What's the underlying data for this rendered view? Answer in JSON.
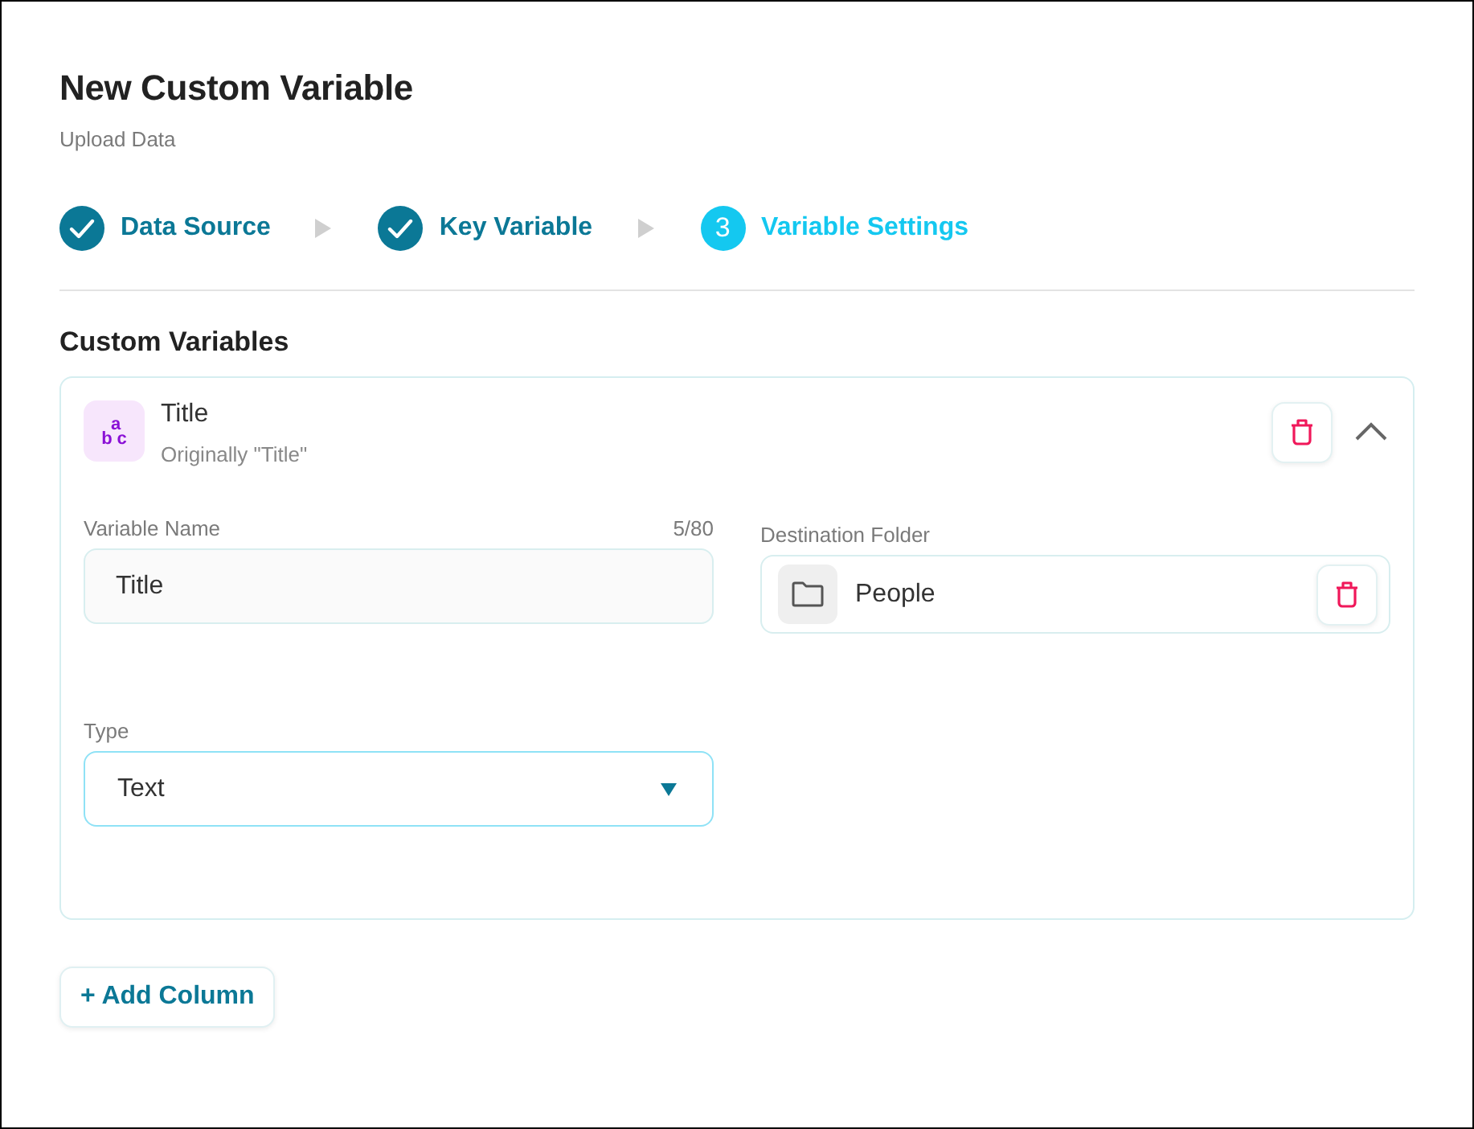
{
  "header": {
    "title": "New Custom Variable",
    "subtitle": "Upload Data"
  },
  "steps": [
    {
      "label": "Data Source",
      "completed": true,
      "selected": false
    },
    {
      "label": "Key Variable",
      "completed": true,
      "selected": false
    },
    {
      "label": "Variable Settings",
      "number": "3",
      "completed": false,
      "selected": true
    }
  ],
  "section": {
    "title": "Custom Variables"
  },
  "variables": [
    {
      "name": "Title",
      "original": "Originally \"Title\"",
      "type_glyph": "abc",
      "expanded": true,
      "variable_name": {
        "label": "Variable Name",
        "counter": "5/80",
        "value": "Title"
      },
      "type": {
        "label": "Type",
        "value": "Text",
        "focused": true
      },
      "destination": {
        "label": "Destination Folder",
        "value": "People"
      }
    }
  ],
  "add_button": {
    "label": "+ Add Column"
  }
}
